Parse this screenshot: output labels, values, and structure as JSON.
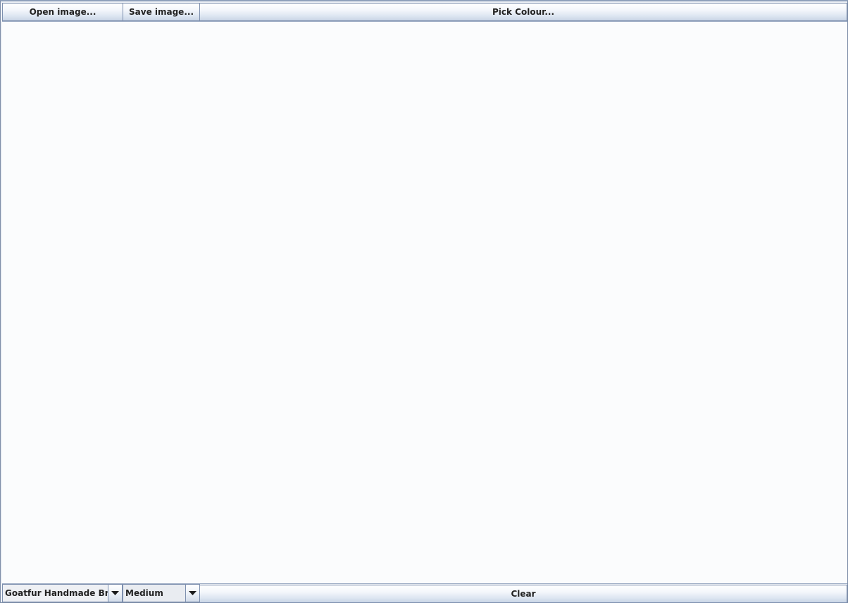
{
  "toolbar": {
    "open_label": "Open image...",
    "save_label": "Save image...",
    "pick_colour_label": "Pick Colour..."
  },
  "bottom_bar": {
    "brush_selected": "Goatfur Handmade Brush",
    "size_selected": "Medium",
    "clear_label": "Clear"
  },
  "colors": {
    "canvas_background": "#fbfcfd",
    "frame_border": "#7a8ba6",
    "button_gradient_top": "#ffffff",
    "button_gradient_bottom": "#c9d5e6"
  },
  "icons": {
    "dropdown_arrow": "chevron-down-icon"
  }
}
